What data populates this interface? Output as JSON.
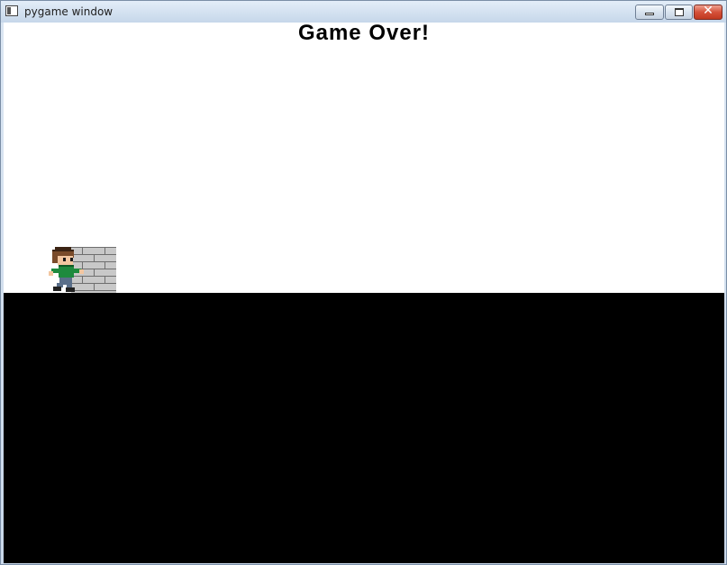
{
  "window": {
    "title": "pygame window",
    "controls": [
      "minimize",
      "maximize",
      "close"
    ],
    "close_glyph": "✕"
  },
  "game": {
    "status_text": "Game Over!",
    "sprites": [
      "player-character",
      "brick-wall"
    ],
    "colors": {
      "sky": "#ffffff",
      "ground": "#000000",
      "text": "#000000",
      "shirt": "#1e8a3e",
      "hair": "#7a4b2a",
      "brick": "#c8c8c8"
    }
  }
}
